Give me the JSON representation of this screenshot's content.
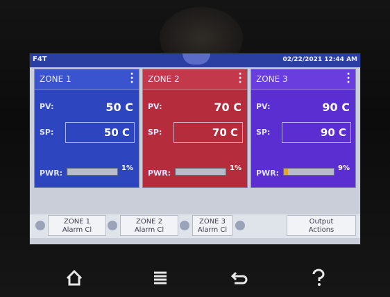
{
  "topbar": {
    "left_label": "F4T",
    "datetime": "02/22/2021 12:44 AM"
  },
  "zones": [
    {
      "title": "ZONE 1",
      "pv_label": "PV:",
      "pv": "50 C",
      "sp_label": "SP:",
      "sp": "50 C",
      "pwr_label": "PWR:",
      "pwr_pct": "1%",
      "pwr_fraction": 0.01
    },
    {
      "title": "ZONE 2",
      "pv_label": "PV:",
      "pv": "70 C",
      "sp_label": "SP:",
      "sp": "70 C",
      "pwr_label": "PWR:",
      "pwr_pct": "1%",
      "pwr_fraction": 0.01
    },
    {
      "title": "ZONE 3",
      "pv_label": "PV:",
      "pv": "90 C",
      "sp_label": "SP:",
      "sp": "90 C",
      "pwr_label": "PWR:",
      "pwr_pct": "9%",
      "pwr_fraction": 0.09
    }
  ],
  "bottom_buttons": [
    {
      "line1": "ZONE 1",
      "line2": "Alarm Cl"
    },
    {
      "line1": "ZONE 2",
      "line2": "Alarm Cl"
    },
    {
      "line1": "ZONE 3",
      "line2": "Alarm Cl"
    },
    {
      "line1": "Output",
      "line2": "Actions"
    }
  ],
  "nav_icons": [
    "home-icon",
    "menu-icon",
    "back-icon",
    "help-icon"
  ],
  "colors": {
    "zone1": "#2d46c0",
    "zone2": "#b52d3c",
    "zone3": "#5a2ed0",
    "pwr_fill": "#e6a52a"
  }
}
